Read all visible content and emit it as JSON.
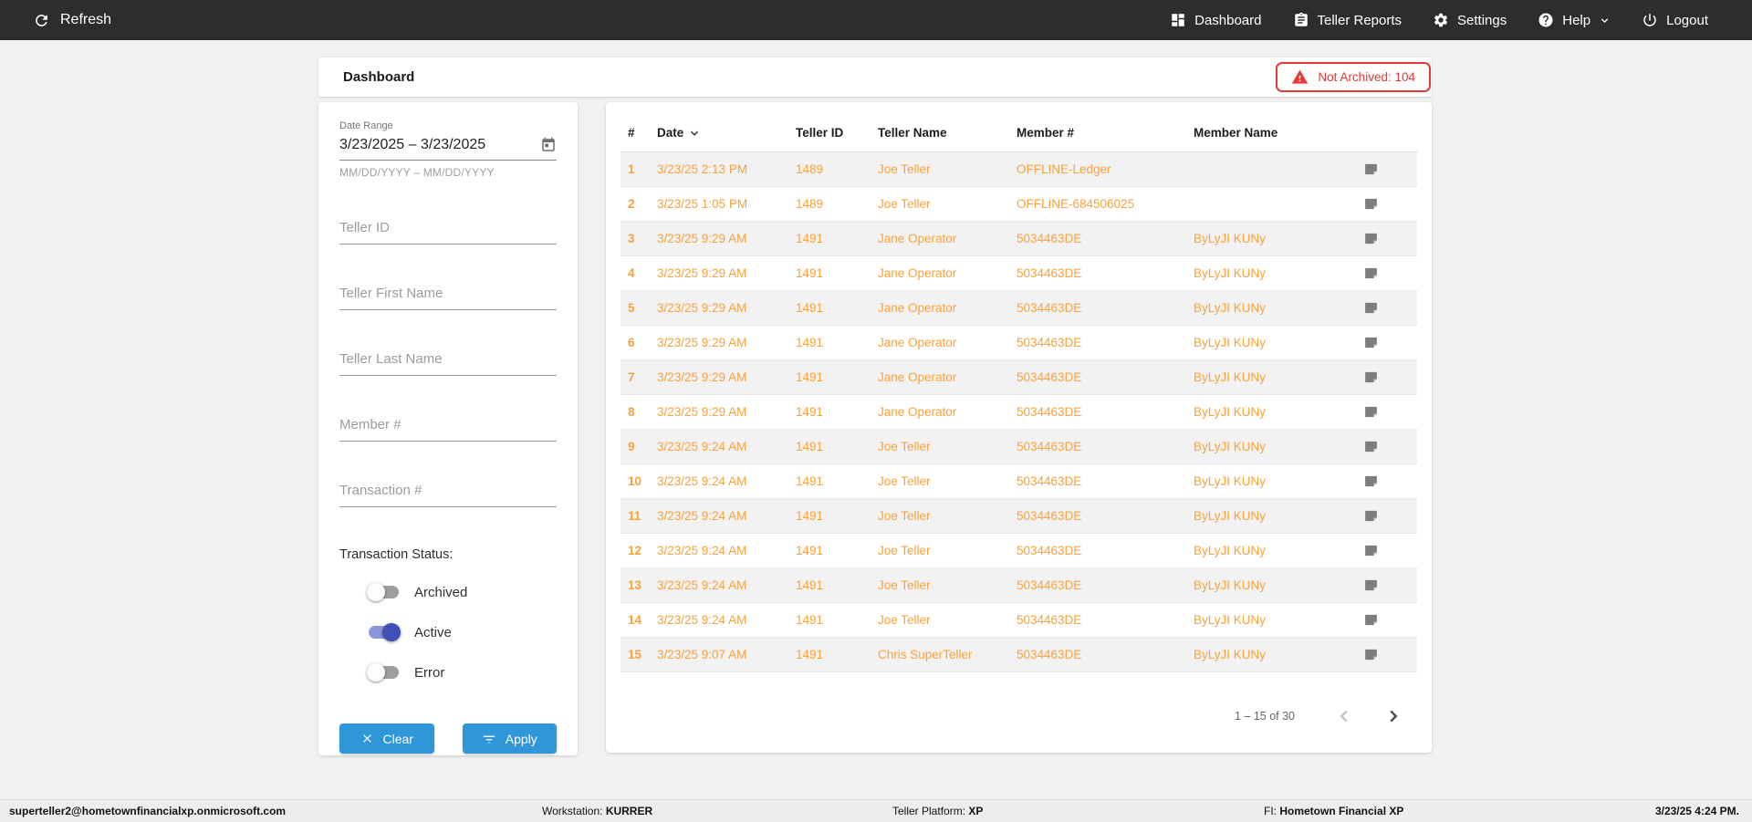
{
  "navbar": {
    "refresh_label": "Refresh",
    "items": [
      {
        "label": "Dashboard"
      },
      {
        "label": "Teller Reports"
      },
      {
        "label": "Settings"
      },
      {
        "label": "Help"
      },
      {
        "label": "Logout"
      }
    ]
  },
  "header": {
    "title": "Dashboard",
    "not_archived_badge": "Not Archived: 104"
  },
  "filters": {
    "date_range": {
      "label": "Date Range",
      "value": "3/23/2025 – 3/23/2025",
      "helper": "MM/DD/YYYY – MM/DD/YYYY"
    },
    "inputs": [
      {
        "placeholder": "Teller ID"
      },
      {
        "placeholder": "Teller First Name"
      },
      {
        "placeholder": "Teller Last Name"
      },
      {
        "placeholder": "Member #"
      },
      {
        "placeholder": "Transaction #"
      }
    ],
    "status": {
      "label": "Transaction Status:",
      "toggles": [
        {
          "label": "Archived",
          "on": false
        },
        {
          "label": "Active",
          "on": true
        },
        {
          "label": "Error",
          "on": false
        }
      ]
    },
    "clear_label": "Clear",
    "apply_label": "Apply"
  },
  "table": {
    "columns": [
      "#",
      "Date",
      "Teller ID",
      "Teller Name",
      "Member #",
      "Member Name"
    ],
    "sorted_by": "Date",
    "rows": [
      {
        "num": "1",
        "date": "3/23/25 2:13 PM",
        "teller_id": "1489",
        "teller_name": "Joe Teller",
        "member_num": "OFFLINE-Ledger",
        "member_name": ""
      },
      {
        "num": "2",
        "date": "3/23/25 1:05 PM",
        "teller_id": "1489",
        "teller_name": "Joe Teller",
        "member_num": "OFFLINE-684506025",
        "member_name": ""
      },
      {
        "num": "3",
        "date": "3/23/25 9:29 AM",
        "teller_id": "1491",
        "teller_name": "Jane Operator",
        "member_num": "5034463DE",
        "member_name": "ByLyJI KUNy"
      },
      {
        "num": "4",
        "date": "3/23/25 9:29 AM",
        "teller_id": "1491",
        "teller_name": "Jane Operator",
        "member_num": "5034463DE",
        "member_name": "ByLyJI KUNy"
      },
      {
        "num": "5",
        "date": "3/23/25 9:29 AM",
        "teller_id": "1491",
        "teller_name": "Jane Operator",
        "member_num": "5034463DE",
        "member_name": "ByLyJI KUNy"
      },
      {
        "num": "6",
        "date": "3/23/25 9:29 AM",
        "teller_id": "1491",
        "teller_name": "Jane Operator",
        "member_num": "5034463DE",
        "member_name": "ByLyJI KUNy"
      },
      {
        "num": "7",
        "date": "3/23/25 9:29 AM",
        "teller_id": "1491",
        "teller_name": "Jane Operator",
        "member_num": "5034463DE",
        "member_name": "ByLyJI KUNy"
      },
      {
        "num": "8",
        "date": "3/23/25 9:29 AM",
        "teller_id": "1491",
        "teller_name": "Jane Operator",
        "member_num": "5034463DE",
        "member_name": "ByLyJI KUNy"
      },
      {
        "num": "9",
        "date": "3/23/25 9:24 AM",
        "teller_id": "1491",
        "teller_name": "Joe Teller",
        "member_num": "5034463DE",
        "member_name": "ByLyJI KUNy"
      },
      {
        "num": "10",
        "date": "3/23/25 9:24 AM",
        "teller_id": "1491",
        "teller_name": "Joe Teller",
        "member_num": "5034463DE",
        "member_name": "ByLyJI KUNy"
      },
      {
        "num": "11",
        "date": "3/23/25 9:24 AM",
        "teller_id": "1491",
        "teller_name": "Joe Teller",
        "member_num": "5034463DE",
        "member_name": "ByLyJI KUNy"
      },
      {
        "num": "12",
        "date": "3/23/25 9:24 AM",
        "teller_id": "1491",
        "teller_name": "Joe Teller",
        "member_num": "5034463DE",
        "member_name": "ByLyJI KUNy"
      },
      {
        "num": "13",
        "date": "3/23/25 9:24 AM",
        "teller_id": "1491",
        "teller_name": "Joe Teller",
        "member_num": "5034463DE",
        "member_name": "ByLyJI KUNy"
      },
      {
        "num": "14",
        "date": "3/23/25 9:24 AM",
        "teller_id": "1491",
        "teller_name": "Joe Teller",
        "member_num": "5034463DE",
        "member_name": "ByLyJI KUNy"
      },
      {
        "num": "15",
        "date": "3/23/25 9:07 AM",
        "teller_id": "1491",
        "teller_name": "Chris SuperTeller",
        "member_num": "5034463DE",
        "member_name": "ByLyJI KUNy"
      }
    ],
    "pagination": {
      "range_label": "1 – 15 of 30"
    }
  },
  "footer": {
    "user": "superteller2@hometownfinancialxp.onmicrosoft.com",
    "workstation_label": "Workstation:",
    "workstation": "KURRER",
    "platform_label": "Teller Platform:",
    "platform": "XP",
    "fi_label": "FI:",
    "fi": "Hometown Financial XP",
    "timestamp": "3/23/25 4:24 PM."
  },
  "colors": {
    "accent_orange": "#f9a13a",
    "button_blue": "#2e96d9",
    "alert_red": "#e53935",
    "toggle_on": "#3f51b5",
    "navbar_dark": "#2d2d2d"
  }
}
